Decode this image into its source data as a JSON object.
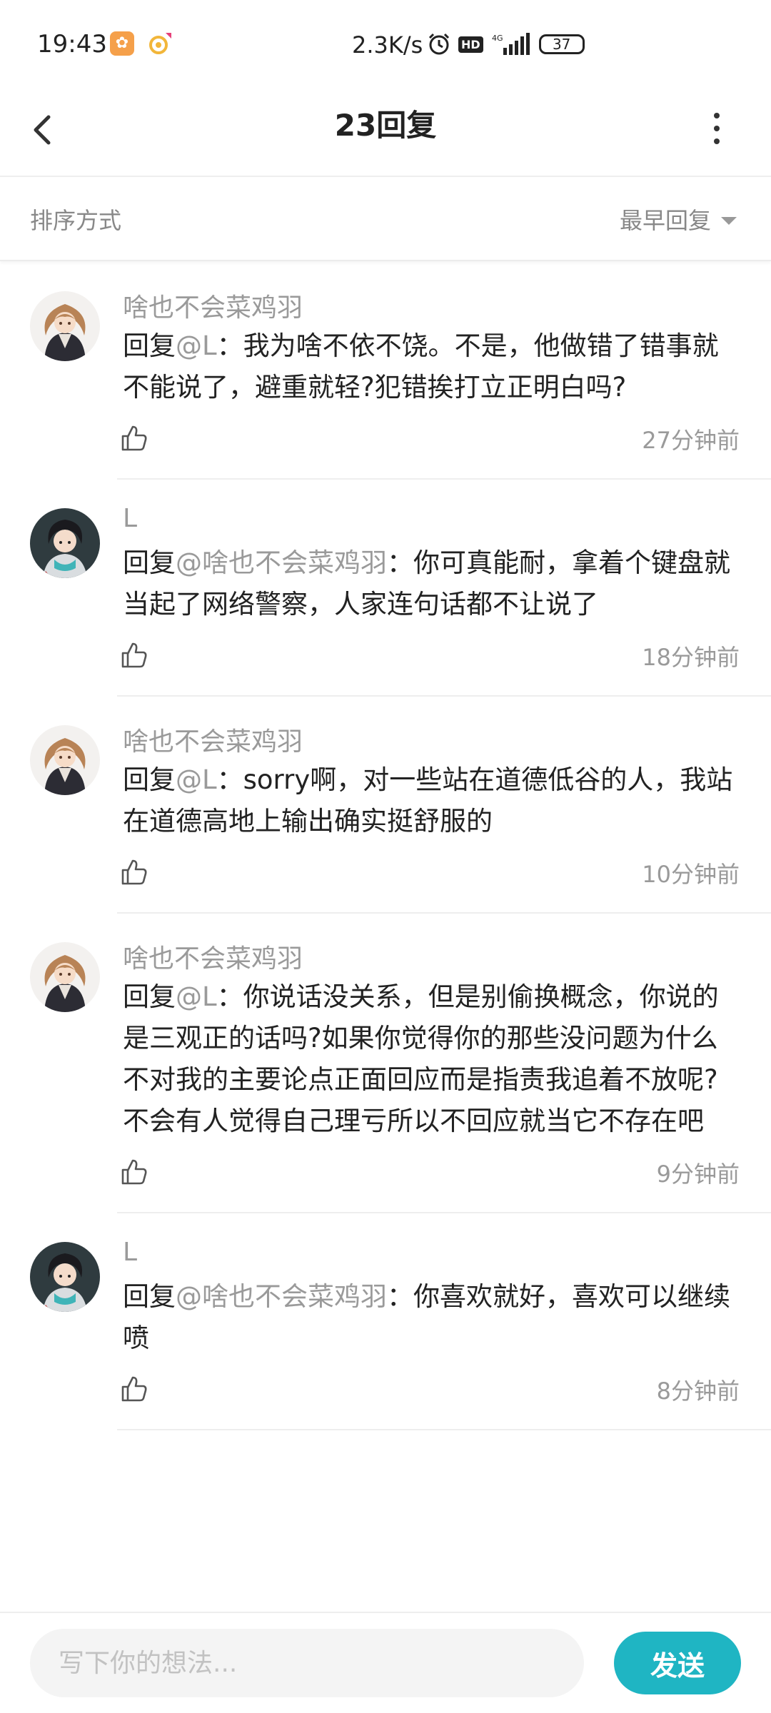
{
  "status_bar": {
    "time": "19:43",
    "speed": "2.3K/s",
    "network": "4G",
    "hd": "HD",
    "battery": "37"
  },
  "header": {
    "title": "23回复"
  },
  "sort": {
    "label": "排序方式",
    "selected": "最早回复"
  },
  "comments": [
    {
      "author": "啥也不会菜鸡羽",
      "prefix": "回复",
      "mention": "@L",
      "sep": "：",
      "text": "我为啥不依不饶。不是，他做错了错事就不能说了，避重就轻?犯错挨打立正明白吗?",
      "time": "27分钟前",
      "avatar": "girl"
    },
    {
      "author": "L",
      "prefix": "回复",
      "mention": "@啥也不会菜鸡羽",
      "sep": "：",
      "text": "你可真能耐，拿着个键盘就当起了网络警察，人家连句话都不让说了",
      "time": "18分钟前",
      "avatar": "boy"
    },
    {
      "author": "啥也不会菜鸡羽",
      "prefix": "回复",
      "mention": "@L",
      "sep": "：",
      "text": "sorry啊，对一些站在道德低谷的人，我站在道德高地上输出确实挺舒服的",
      "time": "10分钟前",
      "avatar": "girl"
    },
    {
      "author": "啥也不会菜鸡羽",
      "prefix": "回复",
      "mention": "@L",
      "sep": "：",
      "text": "你说话没关系，但是别偷换概念，你说的是三观正的话吗?如果你觉得你的那些没问题为什么不对我的主要论点正面回应而是指责我追着不放呢?不会有人觉得自己理亏所以不回应就当它不存在吧",
      "time": "9分钟前",
      "avatar": "girl"
    },
    {
      "author": "L",
      "prefix": "回复",
      "mention": "@啥也不会菜鸡羽",
      "sep": "：",
      "text": "你喜欢就好，喜欢可以继续喷",
      "time": "8分钟前",
      "avatar": "boy"
    }
  ],
  "input": {
    "placeholder": "写下你的想法...",
    "send_label": "发送"
  },
  "colors": {
    "accent": "#1fb5c3",
    "muted": "#9a9a9a"
  }
}
